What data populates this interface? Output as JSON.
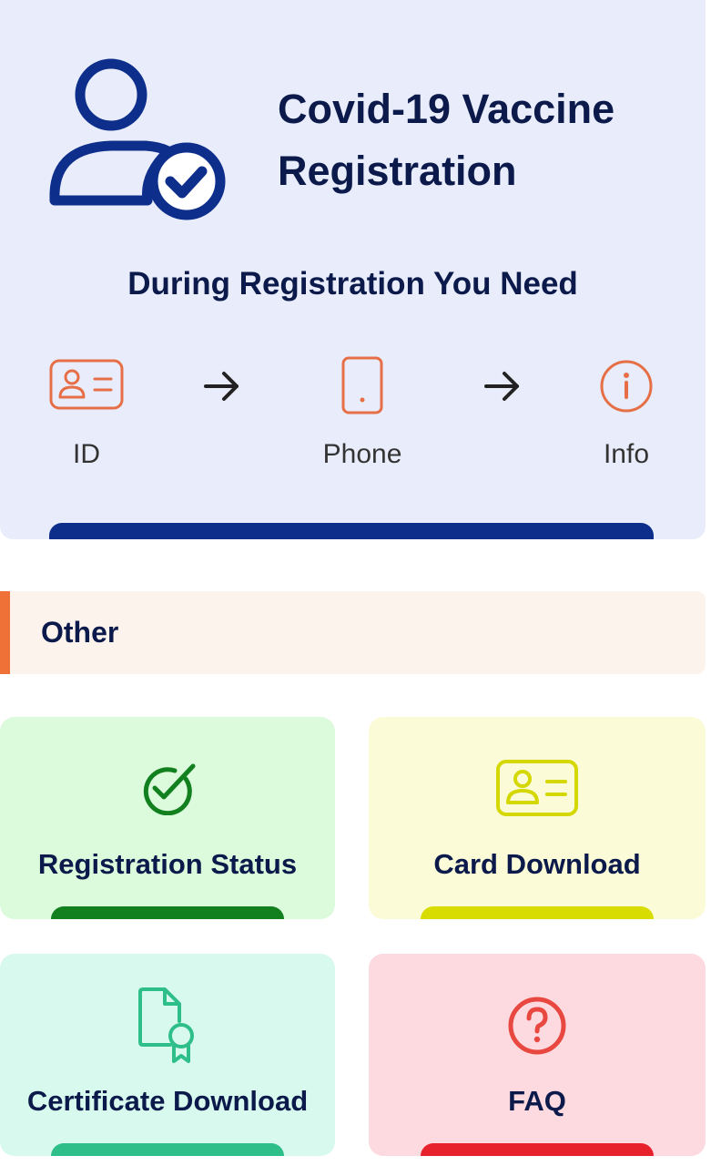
{
  "hero": {
    "title_line1": "Covid-19 Vaccine",
    "title_line2": "Registration",
    "subtitle": "During Registration You Need",
    "requirements": [
      {
        "label": "ID",
        "icon": "id-card-icon"
      },
      {
        "label": "Phone",
        "icon": "phone-icon"
      },
      {
        "label": "Info",
        "icon": "info-icon"
      }
    ]
  },
  "section": {
    "title": "Other"
  },
  "cards": [
    {
      "label": "Registration Status",
      "icon": "check-badge-icon",
      "bg": "#dcfadc",
      "accent": "#12801f"
    },
    {
      "label": "Card Download",
      "icon": "id-card-icon",
      "bg": "#fbfbd8",
      "accent": "#d9dc00"
    },
    {
      "label": "Certificate Download",
      "icon": "certificate-icon",
      "bg": "#d8faee",
      "accent": "#2dbe8a"
    },
    {
      "label": "FAQ",
      "icon": "question-icon",
      "bg": "#fdd9e0",
      "accent": "#e8222d"
    }
  ],
  "colors": {
    "brand": "#0e2e8c",
    "hero_bg": "#e9edfb",
    "orange": "#f07138"
  }
}
